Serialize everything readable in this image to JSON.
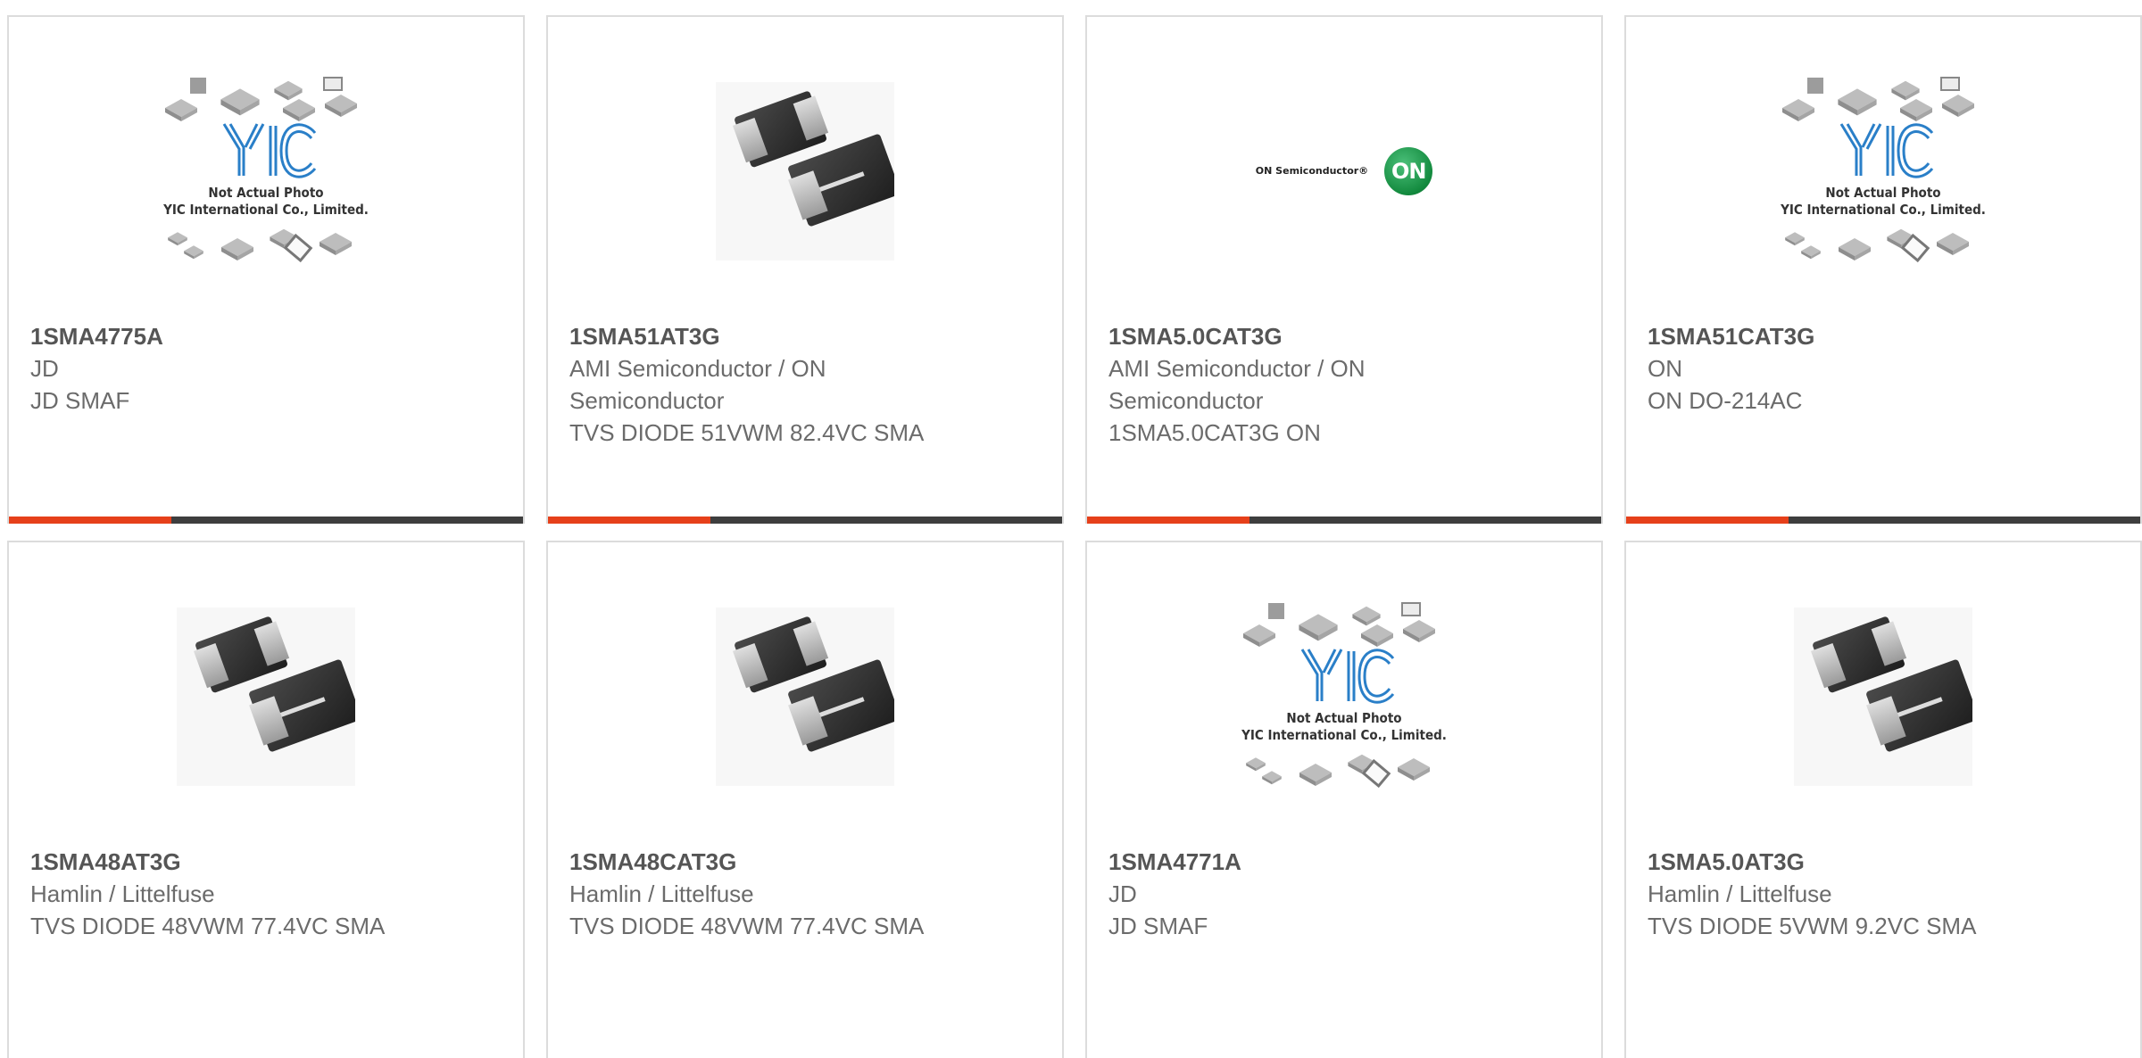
{
  "placeholder": {
    "line1": "Not Actual Photo",
    "line2": "YIC International Co., Limited.",
    "brand": "YIC"
  },
  "on_logo": {
    "text": "ON Semiconductor®",
    "mark": "ON"
  },
  "products": [
    {
      "part": "1SMA4775A",
      "mfr": "JD",
      "desc": "JD SMAF",
      "image": "yic-placeholder"
    },
    {
      "part": "1SMA51AT3G",
      "mfr": "AMI Semiconductor / ON Semiconductor",
      "desc": "TVS DIODE 51VWM 82.4VC SMA",
      "image": "sma-diode"
    },
    {
      "part": "1SMA5.0CAT3G",
      "mfr": "AMI Semiconductor / ON Semiconductor",
      "desc": "1SMA5.0CAT3G ON",
      "image": "on-semiconductor-logo"
    },
    {
      "part": "1SMA51CAT3G",
      "mfr": "ON",
      "desc": "ON DO-214AC",
      "image": "yic-placeholder"
    },
    {
      "part": "1SMA48AT3G",
      "mfr": "Hamlin / Littelfuse",
      "desc": "TVS DIODE 48VWM 77.4VC SMA",
      "image": "sma-diode"
    },
    {
      "part": "1SMA48CAT3G",
      "mfr": "Hamlin / Littelfuse",
      "desc": "TVS DIODE 48VWM 77.4VC SMA",
      "image": "sma-diode"
    },
    {
      "part": "1SMA4771A",
      "mfr": "JD",
      "desc": "JD SMAF",
      "image": "yic-placeholder"
    },
    {
      "part": "1SMA5.0AT3G",
      "mfr": "Hamlin / Littelfuse",
      "desc": "TVS DIODE 5VWM 9.2VC SMA",
      "image": "sma-diode"
    }
  ],
  "colors": {
    "accent": "#e6401a",
    "bar": "#3e3e3e",
    "border": "#dcdcdc",
    "part_text": "#555555",
    "body_text": "#6b6b6b"
  }
}
